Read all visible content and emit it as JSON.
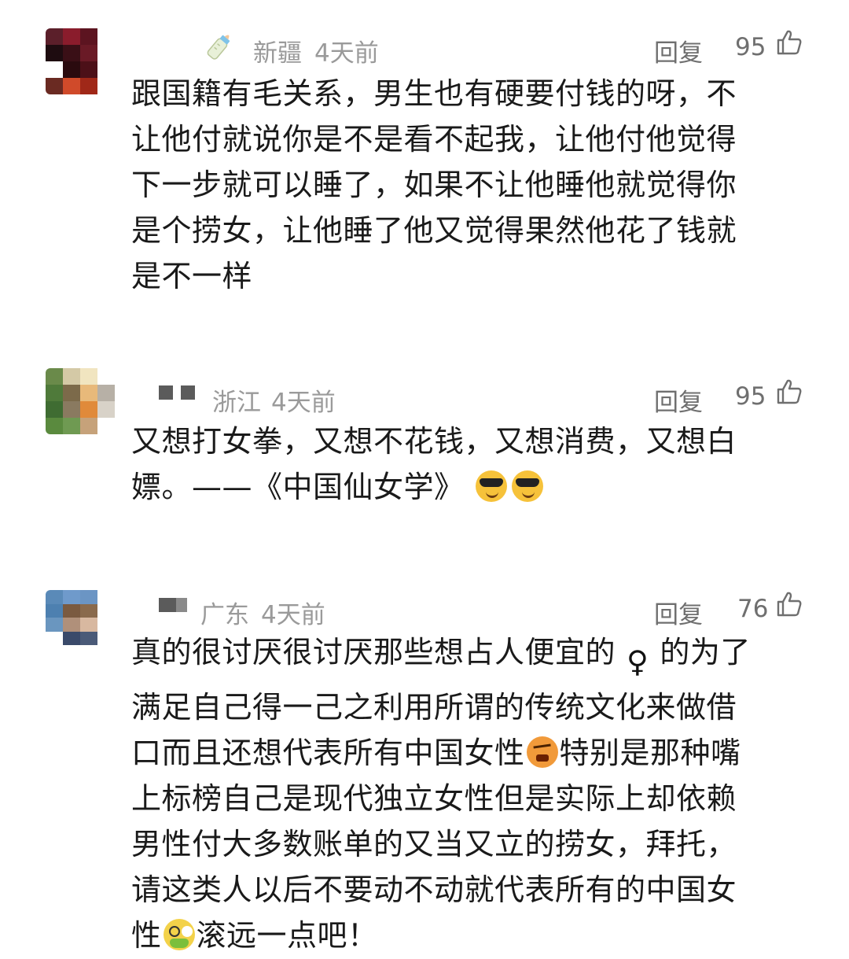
{
  "comments": [
    {
      "region": "新疆",
      "time": "4天前",
      "reply_label": "回复",
      "likes": "95",
      "badge_icon": "baby-bottle-icon",
      "lines": [
        "跟国籍有毛关系，男生也有硬要付钱的呀，不",
        "让他付就说你是不是看不起我，让他付他觉得",
        "下一步就可以睡了，如果不让他睡他就觉得你",
        "是个捞女，让他睡了他又觉得果然他花了钱就",
        "是不一样"
      ]
    },
    {
      "region": "浙江",
      "time": "4天前",
      "reply_label": "回复",
      "likes": "95",
      "lines": [
        "又想打女拳，又想不花钱，又想消费，又想白",
        "嫖。——《中国仙女学》"
      ],
      "emojis": [
        "sunglasses-emoji",
        "sunglasses-emoji"
      ]
    },
    {
      "region": "广东",
      "time": "4天前",
      "reply_label": "回复",
      "likes": "76",
      "line1_a": "真的很讨厌很讨厌那些想占人便宜的",
      "female_symbol": "♀",
      "line1_b": "的为了",
      "line2": "满足自己得一己之利用所谓的传统文化来做借",
      "line3_a": "口而且还想代表所有中国女性",
      "line3_b": "特别是那种嘴",
      "line4": "上标榜自己是现代独立女性但是实际上却依赖",
      "line5": "男性付大多数账单的又当又立的捞女，拜托，",
      "line6": "请这类人以后不要动不动就代表所有的中国女",
      "line7_a": "性",
      "line7_b": "滚远一点吧！"
    }
  ],
  "colors": {
    "meta_text": "#9a9a9a",
    "body_text": "#1a1a1a",
    "action_text": "#6f6f6f"
  }
}
